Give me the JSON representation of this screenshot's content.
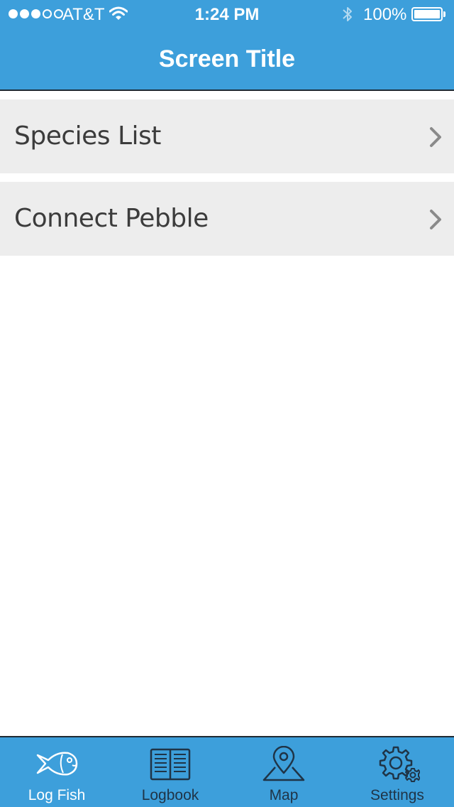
{
  "status_bar": {
    "carrier": "AT&T",
    "time": "1:24 PM",
    "battery": "100%",
    "signal_bars": 3,
    "signal_total": 5
  },
  "nav": {
    "title": "Screen Title"
  },
  "list": {
    "items": [
      {
        "label": "Species List",
        "icon": "chevron-right-icon"
      },
      {
        "label": "Connect Pebble",
        "icon": "chevron-right-icon"
      }
    ]
  },
  "tabbar": {
    "tabs": [
      {
        "label": "Log Fish",
        "icon": "fish-icon",
        "active": true
      },
      {
        "label": "Logbook",
        "icon": "book-icon",
        "active": false
      },
      {
        "label": "Map",
        "icon": "map-pin-icon",
        "active": false
      },
      {
        "label": "Settings",
        "icon": "gears-icon",
        "active": false
      }
    ]
  },
  "colors": {
    "accent": "#3d9fdb",
    "row_bg": "#ededed",
    "tab_inactive": "#1f3447",
    "tab_active": "#ffffff"
  }
}
